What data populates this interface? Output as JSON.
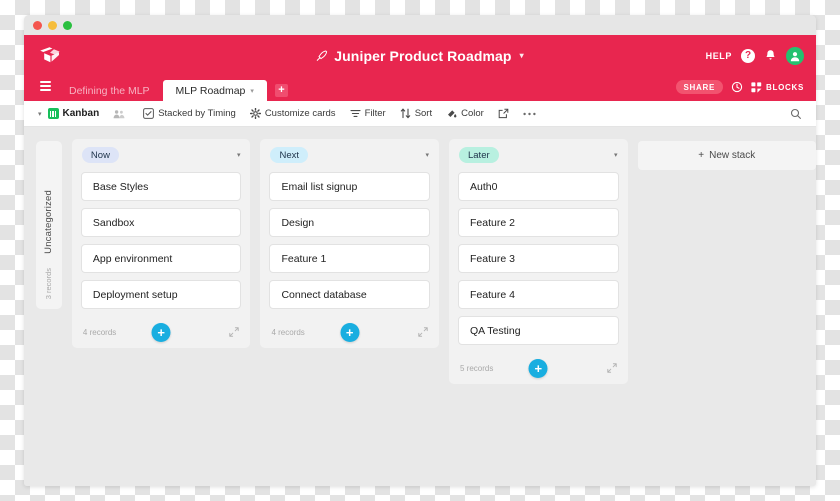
{
  "window": {
    "traffic_lights": [
      "close",
      "minimize",
      "zoom"
    ]
  },
  "header": {
    "logo": "airtable-logo",
    "doc_title": "Juniper Product Roadmap",
    "doc_title_icon": "rocket-icon",
    "doc_title_caret": "▾",
    "help_label": "HELP",
    "question_icon": "?",
    "bell_icon": "bell-icon",
    "avatar_icon": "user-avatar",
    "brand_color": "#e8264f"
  },
  "tabbar": {
    "menu_icon": "hamburger-icon",
    "tabs": [
      {
        "label": "Defining the MLP",
        "active": false
      },
      {
        "label": "MLP Roadmap",
        "active": true,
        "caret": "▾"
      }
    ],
    "add_tab_label": "+",
    "share_label": "SHARE",
    "history_icon": "history-clock-icon",
    "blocks_icon": "blocks-grid-icon",
    "blocks_label": "BLOCKS"
  },
  "viewbar": {
    "collapse_caret": "▾",
    "view_icon": "kanban-icon",
    "view_name": "Kanban",
    "collaborators_icon": "collaborators-icon",
    "items": [
      {
        "label": "Stacked by Timing",
        "icon": "stack-checkbox-icon"
      },
      {
        "label": "Customize cards",
        "icon": "gear-icon"
      },
      {
        "label": "Filter",
        "icon": "filter-icon"
      },
      {
        "label": "Sort",
        "icon": "sort-icon"
      },
      {
        "label": "Color",
        "icon": "paint-icon"
      }
    ],
    "share_view_icon": "external-link-icon",
    "more_icon": "ellipsis-icon",
    "search_icon": "search-icon"
  },
  "board": {
    "collapsed_stack": {
      "label": "Uncategorized",
      "records": "3 records"
    },
    "stacks": [
      {
        "name": "Now",
        "pill_color": "#dde4f7",
        "caret": "▾",
        "cards": [
          {
            "title": "Base Styles"
          },
          {
            "title": "Sandbox"
          },
          {
            "title": "App environment"
          },
          {
            "title": "Deployment setup"
          }
        ],
        "records": "4 records",
        "add_label": "+",
        "expand_icon": "expand-icon"
      },
      {
        "name": "Next",
        "pill_color": "#cfeefb",
        "caret": "▾",
        "cards": [
          {
            "title": "Email list signup"
          },
          {
            "title": "Design"
          },
          {
            "title": "Feature 1"
          },
          {
            "title": "Connect database"
          }
        ],
        "records": "4 records",
        "add_label": "+",
        "expand_icon": "expand-icon"
      },
      {
        "name": "Later",
        "pill_color": "#b8f0e0",
        "caret": "▾",
        "cards": [
          {
            "title": "Auth0"
          },
          {
            "title": "Feature 2"
          },
          {
            "title": "Feature 3"
          },
          {
            "title": "Feature 4"
          },
          {
            "title": "QA Testing"
          }
        ],
        "records": "5 records",
        "add_label": "+",
        "expand_icon": "expand-icon"
      }
    ],
    "new_stack": {
      "plus": "+",
      "label": "New stack"
    }
  }
}
